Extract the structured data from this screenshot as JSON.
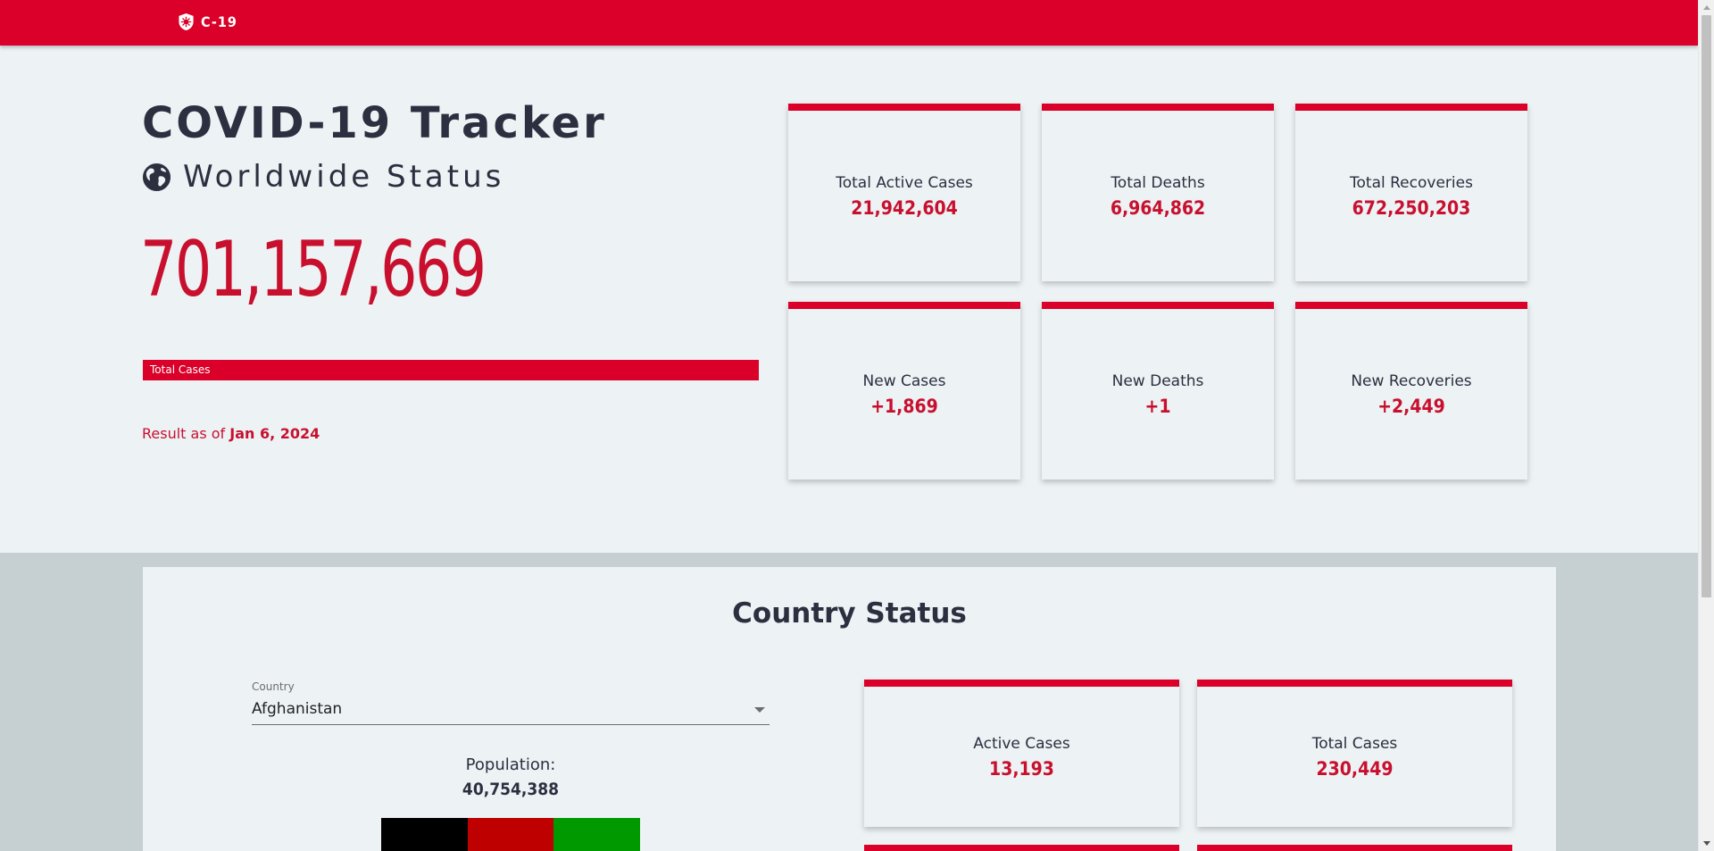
{
  "navbar": {
    "brand_name": "C-19",
    "brand_icon": "shield-virus-icon"
  },
  "hero": {
    "title": "COVID-19 Tracker",
    "subtitle": "Worldwide Status",
    "subtitle_icon": "globe-icon",
    "total_cases_value": "701,157,669",
    "total_cases_label": "Total Cases",
    "result_prefix": "Result as of ",
    "result_date": "Jan 6, 2024"
  },
  "global_stats": [
    {
      "label": "Total Active Cases",
      "value": "21,942,604"
    },
    {
      "label": "Total Deaths",
      "value": "6,964,862"
    },
    {
      "label": "Total Recoveries",
      "value": "672,250,203"
    },
    {
      "label": "New Cases",
      "value": "+1,869"
    },
    {
      "label": "New Deaths",
      "value": "+1"
    },
    {
      "label": "New Recoveries",
      "value": "+2,449"
    }
  ],
  "country_status": {
    "title": "Country Status",
    "select_label": "Country",
    "selected_country": "Afghanistan",
    "population_label": "Population:",
    "population_value": "40,754,388",
    "flag_colors": [
      "#000000",
      "#be0000",
      "#009a00"
    ],
    "cards": [
      {
        "label": "Active Cases",
        "value": "13,193"
      },
      {
        "label": "Total Cases",
        "value": "230,449"
      }
    ]
  },
  "colors": {
    "accent": "#da0029",
    "number_red": "#c8102e",
    "text_dark": "#2b2f3f",
    "page_bg": "#edf2f5",
    "section_bg": "#c6cfd2"
  }
}
